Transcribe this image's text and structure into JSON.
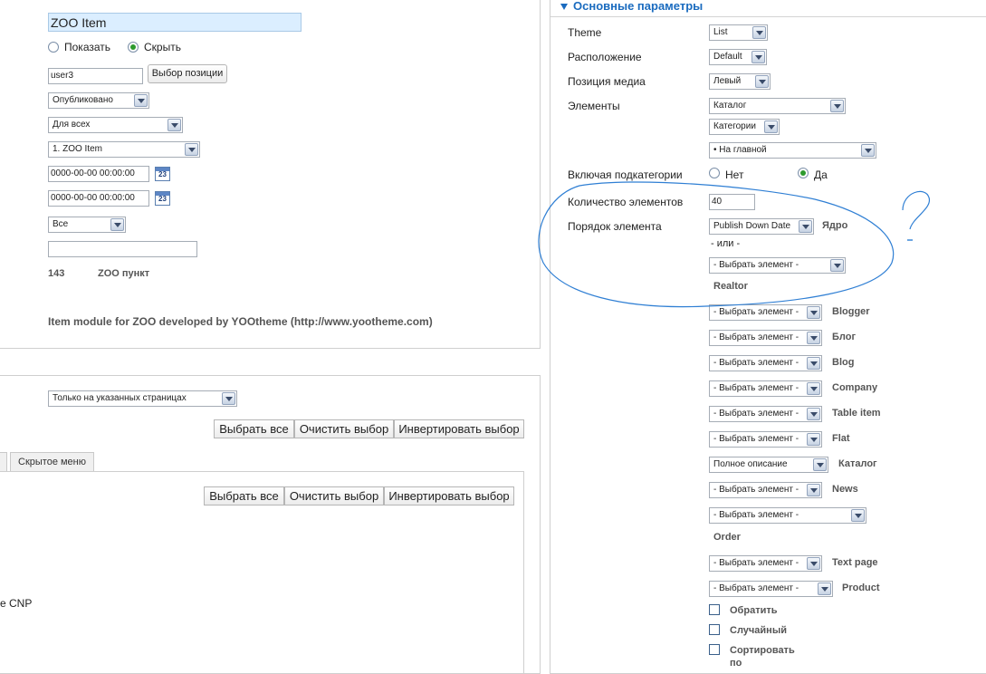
{
  "left_top": {
    "title_value": "ZOO Item",
    "radio_show": "Показать",
    "radio_hide": "Скрыть",
    "position_value": "user3",
    "position_button": "Выбор позиции",
    "published_select": "Опубликовано",
    "access_select": "Для всех",
    "order_select": "1. ZOO Item",
    "publish_up": "0000-00-00 00:00:00",
    "publish_down": "0000-00-00 00:00:00",
    "calendar_day": "23",
    "language_select": "Все",
    "note_value": "",
    "module_id": "143",
    "module_type": "ZOO пункт",
    "description": "Item module for ZOO developed by YOOtheme (http://www.yootheme.com)"
  },
  "menu_assignment": {
    "assignment_select": "Только на указанных страницах",
    "select_all": "Выбрать все",
    "clear_selection": "Очистить выбор",
    "invert_selection": "Инвертировать выбор",
    "tab_hidden_menu": "Скрытое меню",
    "partial_text": "e CNP"
  },
  "params": {
    "header": "Основные параметры",
    "theme_label": "Theme",
    "theme_value": "List",
    "layout_label": "Расположение",
    "layout_value": "Default",
    "media_label": "Позиция медиа",
    "media_value": "Левый",
    "elements_label": "Элементы",
    "elements_value": "Каталог",
    "categories_value": "Категории",
    "frontpage_value": "• На главной",
    "subcat_label": "Включая подкатегории",
    "subcat_no": "Нет",
    "subcat_yes": "Да",
    "count_label": "Количество элементов",
    "count_value": "40",
    "order_label": "Порядок элемента",
    "order_value": "Publish Down Date",
    "core_label": "Ядро",
    "or_label": "- или -",
    "choose_element": "- Выбрать элемент -",
    "realtor_label": "Realtor",
    "rows": [
      {
        "value": "- Выбрать элемент -",
        "label": "Blogger"
      },
      {
        "value": "- Выбрать элемент -",
        "label": "Блог"
      },
      {
        "value": "- Выбрать элемент -",
        "label": "Blog"
      },
      {
        "value": "- Выбрать элемент -",
        "label": "Company"
      },
      {
        "value": "- Выбрать элемент -",
        "label": "Table item"
      },
      {
        "value": "- Выбрать элемент -",
        "label": "Flat"
      },
      {
        "value": "Полное описание",
        "label": "Каталог"
      },
      {
        "value": "- Выбрать элемент -",
        "label": "News"
      }
    ],
    "order_select_value": "- Выбрать элемент -",
    "order_type_label": "Order",
    "textpage_value": "- Выбрать элемент -",
    "textpage_label": "Text page",
    "product_value": "- Выбрать элемент -",
    "product_label": "Product",
    "reverse_label": "Обратить",
    "random_label": "Случайный",
    "sort_label_1": "Сортировать",
    "sort_label_2": "по"
  },
  "annotation": {
    "color": "#2f7fd4",
    "question_mark": "?"
  }
}
